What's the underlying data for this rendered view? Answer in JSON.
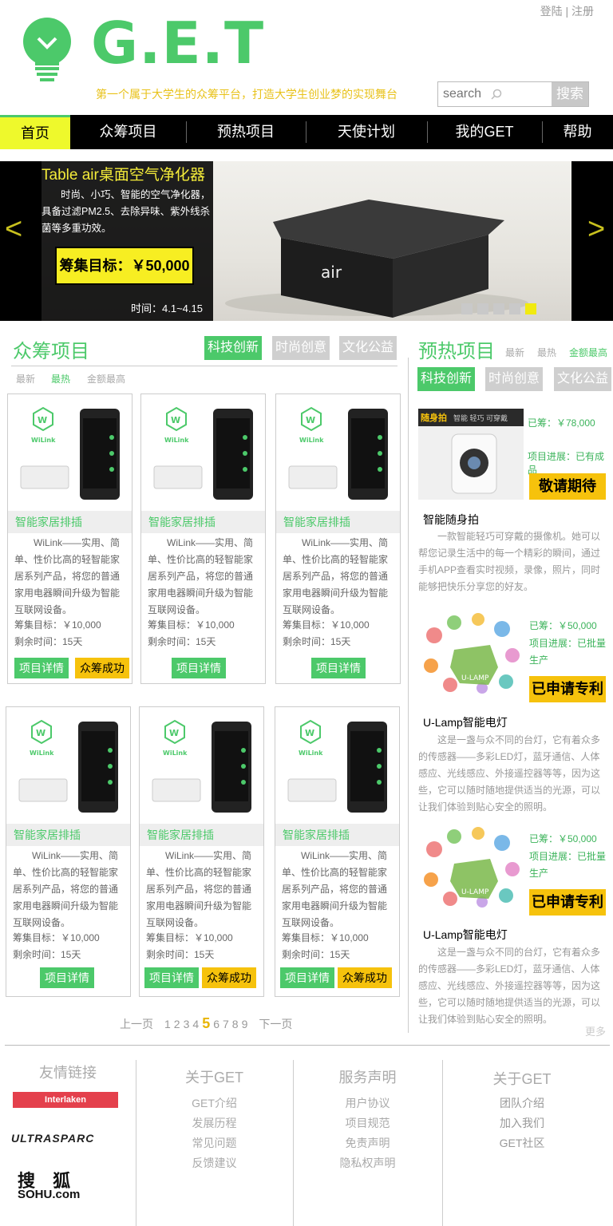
{
  "top_links": {
    "login": "登陆",
    "separator": "|",
    "register": "注册"
  },
  "logo": {
    "text": "G.E.T"
  },
  "slogan": "第一个属于大学生的众筹平台，打造大学生创业梦的实现舞台",
  "search": {
    "placeholder": "search",
    "button": "搜索"
  },
  "nav": [
    {
      "label": "首页",
      "active": true
    },
    {
      "label": "众筹项目"
    },
    {
      "label": "预热项目"
    },
    {
      "label": "天使计划"
    },
    {
      "label": "我的GET"
    },
    {
      "label": "帮助"
    }
  ],
  "banner": {
    "title": "Table air桌面空气净化器",
    "desc": "时尚、小巧、智能的空气净化器，具备过滤PM2.5、去除异味、紫外线杀菌等多重功效。",
    "goal": "筹集目标：￥50,000",
    "time": "时间：4.1~4.15",
    "prev": "<",
    "next": ">",
    "product_label": "air",
    "active_slide": 5
  },
  "crowdfunding": {
    "title": "众筹项目",
    "tags": [
      "科技创新",
      "时尚创意",
      "文化公益"
    ],
    "sort": [
      "最新",
      "最热",
      "金额最高"
    ],
    "cards": [
      {
        "name": "智能家居排插",
        "desc": "WiLink——实用、简单、性价比高的轻智能家居系列产品，将您的普通家用电器瞬间升级为智能互联网设备。",
        "goal": "筹集目标：￥10,000",
        "remain": "剩余时间：15天",
        "detail": "项目详情",
        "success": "众筹成功"
      },
      {
        "name": "智能家居排插",
        "desc": "WiLink——实用、简单、性价比高的轻智能家居系列产品，将您的普通家用电器瞬间升级为智能互联网设备。",
        "goal": "筹集目标：￥10,000",
        "remain": "剩余时间：15天",
        "detail": "项目详情",
        "success": ""
      },
      {
        "name": "智能家居排插",
        "desc": "WiLink——实用、简单、性价比高的轻智能家居系列产品，将您的普通家用电器瞬间升级为智能互联网设备。",
        "goal": "筹集目标：￥10,000",
        "remain": "剩余时间：15天",
        "detail": "项目详情",
        "success": ""
      },
      {
        "name": "智能家居排插",
        "desc": "WiLink——实用、简单、性价比高的轻智能家居系列产品，将您的普通家用电器瞬间升级为智能互联网设备。",
        "goal": "筹集目标：￥10,000",
        "remain": "剩余时间：15天",
        "detail": "项目详情",
        "success": ""
      },
      {
        "name": "智能家居排插",
        "desc": "WiLink——实用、简单、性价比高的轻智能家居系列产品，将您的普通家用电器瞬间升级为智能互联网设备。",
        "goal": "筹集目标：￥10,000",
        "remain": "剩余时间：15天",
        "detail": "项目详情",
        "success": "众筹成功"
      },
      {
        "name": "智能家居排插",
        "desc": "WiLink——实用、简单、性价比高的轻智能家居系列产品，将您的普通家用电器瞬间升级为智能互联网设备。",
        "goal": "筹集目标：￥10,000",
        "remain": "剩余时间：15天",
        "detail": "项目详情",
        "success": "众筹成功"
      }
    ],
    "card_brand": "WiLink",
    "pager": {
      "prev": "上一页",
      "pages": [
        "1",
        "2",
        "3",
        "4",
        "5",
        "6",
        "7",
        "8",
        "9"
      ],
      "current": "5",
      "next": "下一页"
    }
  },
  "preheat": {
    "title": "预热项目",
    "sort": [
      "最新",
      "最热",
      "金额最高"
    ],
    "tags": [
      "科技创新",
      "时尚创意",
      "文化公益"
    ],
    "items": [
      {
        "raised": "已筹：￥78,000",
        "progress": "项目进展：已有成品",
        "badge": "敬请期待",
        "title": "智能随身拍",
        "desc": "一款智能轻巧可穿戴的摄像机。她可以帮您记录生活中的每一个精彩的瞬间，通过手机APP查看实时视频，录像，照片，同时能够把快乐分享您的好友。",
        "img_caption": "随身拍",
        "img_sub": "智能 轻巧 可穿戴"
      },
      {
        "raised": "已筹：￥50,000",
        "progress": "项目进展：已批量生产",
        "badge": "已申请专利",
        "title": "U-Lamp智能电灯",
        "desc": "这是一盏与众不同的台灯，它有着众多的传感器——多彩LED灯，蓝牙通信、人体感应、光线感应、外接遥控器等等，因为这些，它可以随时随地提供适当的光源，可以让我们体验到贴心安全的照明。",
        "img_caption": "U-LAMP"
      },
      {
        "raised": "已筹：￥50,000",
        "progress": "项目进展：已批量生产",
        "badge": "已申请专利",
        "title": "U-Lamp智能电灯",
        "desc": "这是一盏与众不同的台灯，它有着众多的传感器——多彩LED灯，蓝牙通信、人体感应、光线感应、外接遥控器等等，因为这些，它可以随时随地提供适当的光源，可以让我们体验到贴心安全的照明。",
        "img_caption": "U-LAMP"
      }
    ],
    "more": "更多"
  },
  "footer": {
    "links_title": "友情链接",
    "partners": [
      "Interlaken",
      "ULTRASPARC",
      "搜 狐",
      "SOHU.com"
    ],
    "cols": [
      {
        "title": "关于GET",
        "items": [
          "GET介绍",
          "发展历程",
          "常见问题",
          "反馈建议"
        ]
      },
      {
        "title": "服务声明",
        "items": [
          "用户协议",
          "项目规范",
          "免责声明",
          "隐私权声明"
        ]
      },
      {
        "title": "关于GET",
        "items": [
          "团队介绍",
          "加入我们",
          "GET社区"
        ]
      }
    ]
  },
  "colors": {
    "brand_green": "#4cc96a",
    "accent_yellow": "#f6c20c",
    "nav_bg": "#000000",
    "nav_active": "#eef92c"
  }
}
